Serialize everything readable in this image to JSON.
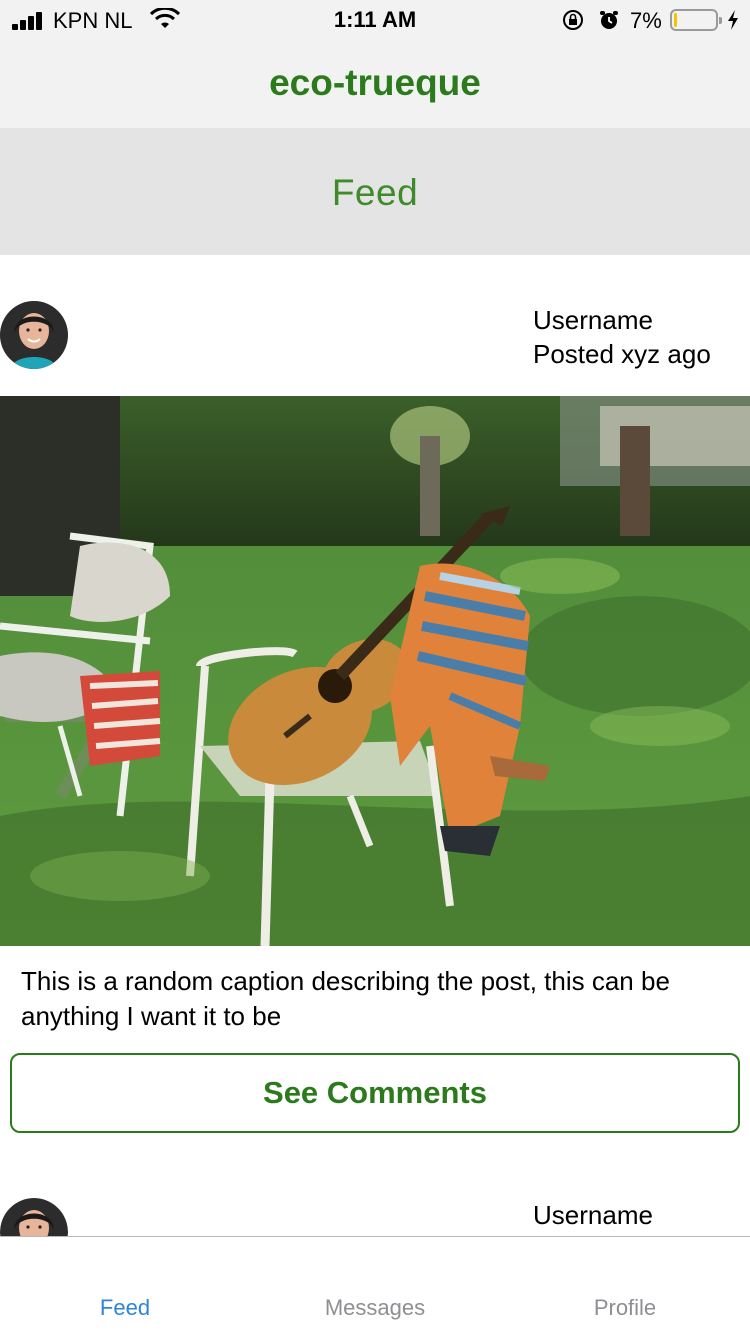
{
  "status_bar": {
    "carrier": "KPN NL",
    "time": "1:11 AM",
    "battery_percent": "7%",
    "battery_level": 0.07,
    "icons": [
      "signal-icon",
      "wifi-icon",
      "orientation-lock-icon",
      "alarm-icon",
      "battery-icon",
      "charging-bolt-icon"
    ]
  },
  "header": {
    "title": "eco-trueque"
  },
  "section": {
    "title": "Feed"
  },
  "posts": [
    {
      "username": "Username",
      "posted": "Posted xyz ago",
      "caption": "This is a random caption describing the post, this can be anything I want it to be",
      "comments_button": "See Comments"
    },
    {
      "username": "Username"
    }
  ],
  "tabs": [
    {
      "label": "Feed",
      "active": true
    },
    {
      "label": "Messages",
      "active": false
    },
    {
      "label": "Profile",
      "active": false
    }
  ],
  "colors": {
    "brand_green": "#2b7a1b",
    "section_green": "#3f8a2a",
    "tab_active": "#2f86d9",
    "tab_inactive": "#8e8e93"
  }
}
